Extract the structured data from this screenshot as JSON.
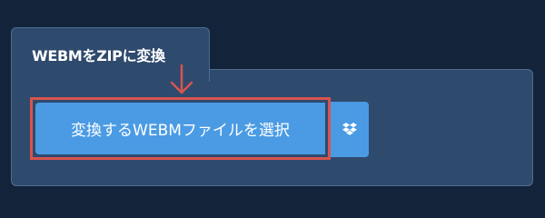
{
  "tab": {
    "title": "WEBMをZIPに変換"
  },
  "upload": {
    "select_label": "変換するWEBMファイルを選択",
    "dropbox_icon": "dropbox-icon"
  },
  "colors": {
    "background": "#13233a",
    "panel": "#2e4a6d",
    "button": "#4a9be4",
    "highlight": "#d9534f"
  }
}
